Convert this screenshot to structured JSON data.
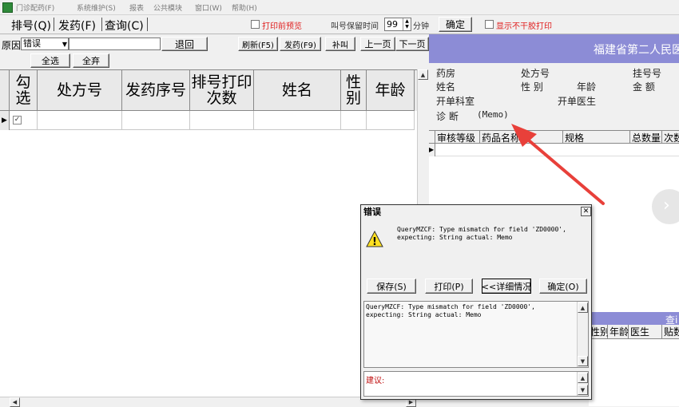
{
  "menubar": {
    "items": [
      "门诊配药(F)",
      "系统维护(S)",
      "报表",
      "公共模块",
      "窗口(W)",
      "帮助(H)"
    ]
  },
  "tabs": [
    "排号(Q)",
    "发药(F)",
    "查询(C)"
  ],
  "toolbar": {
    "print_preview": "打印前预览",
    "call_time_label": "叫号保留时间",
    "call_time_value": "99",
    "minutes_label": "分钟",
    "confirm": "确定",
    "no_print_label": "显示不干胶打印"
  },
  "filter": {
    "reason_label": "原因",
    "reason_value": "错误",
    "retreat": "退回",
    "refresh": "刷新(F5)",
    "dispense": "发药(F9)",
    "recall": "补叫",
    "prev_page": "上一页",
    "next_page": "下一页",
    "select_all": "全选",
    "deselect_all": "全弃"
  },
  "table": {
    "columns": [
      "勾选",
      "处方号",
      "发药序号",
      "排号打印次数",
      "姓名",
      "性别",
      "年龄"
    ],
    "rows": [
      {
        "checked": true
      }
    ]
  },
  "right": {
    "hospital": "福建省第二人民医",
    "pharmacy": "药房",
    "rx_no": "处方号",
    "queue_no": "挂号号",
    "name": "姓名",
    "sex": "性 别",
    "age": "年龄",
    "amount": "金 额",
    "dept": "开单科室",
    "doctor": "开单医生",
    "diagnosis_label": "诊 断",
    "diagnosis_value": "(Memo)",
    "grid_columns": [
      "审核等级",
      "药品名称",
      "规格",
      "总数量",
      "次数"
    ],
    "query_label": "查i",
    "lower_columns": [
      "性别",
      "年龄",
      "医生",
      "贴数"
    ]
  },
  "dialog": {
    "title": "错误",
    "message": "QueryMZCF: Type mismatch for field 'ZD0000',\nexpecting: String actual: Memo",
    "save": "保存(S)",
    "print": "打印(P)",
    "details": "<<详细情况",
    "ok": "确定(O)",
    "detail_text": "QueryMZCF: Type mismatch for field 'ZD0000',\nexpecting: String actual: Memo",
    "suggest_label": "建议:"
  },
  "colors": {
    "banner": "#8c8cd6",
    "red": "#e02020",
    "arrow": "#e8403a"
  }
}
